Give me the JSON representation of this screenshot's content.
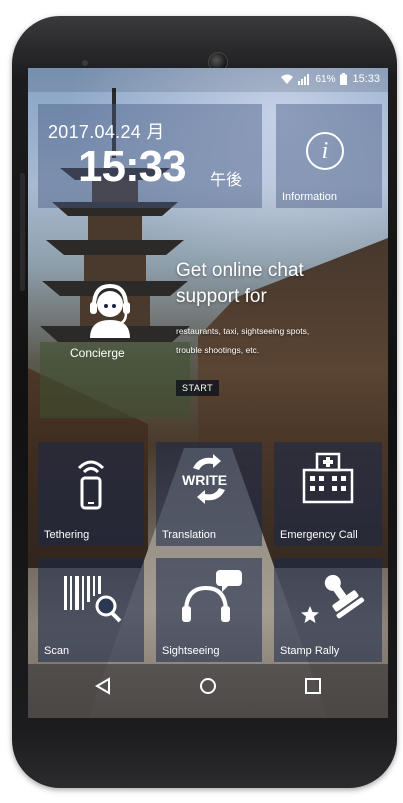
{
  "status_bar": {
    "battery_percent": "61%",
    "time": "15:33",
    "icons": [
      "wifi-icon",
      "signal-icon",
      "battery-icon"
    ]
  },
  "clock": {
    "date": "2017.04.24 月",
    "time": "15:33",
    "ampm": "午後"
  },
  "information": {
    "label": "Information",
    "icon": "info-icon"
  },
  "concierge": {
    "label": "Concierge",
    "icon": "headset-agent-icon",
    "headline_line1": "Get online chat",
    "headline_line2": "support for",
    "subtext_line1": "restaurants, taxi, sightseeing spots,",
    "subtext_line2": "trouble shootings, etc.",
    "start_label": "START"
  },
  "tiles": [
    {
      "label": "Tethering",
      "icon": "phone-wifi-icon"
    },
    {
      "label": "Translation",
      "icon": "translate-arrows-icon",
      "icon_text": "WRITE"
    },
    {
      "label": "Emergency Call",
      "icon": "hospital-icon"
    },
    {
      "label": "Scan",
      "icon": "barcode-scan-icon"
    },
    {
      "label": "Sightseeing",
      "icon": "headphones-chat-icon"
    },
    {
      "label": "Stamp Rally",
      "icon": "stamp-icon"
    }
  ],
  "nav_bar": {
    "items": [
      "back-icon",
      "home-icon",
      "recents-icon"
    ]
  },
  "colors": {
    "tile_bg": "#19284b",
    "text": "#ffffff",
    "phone_body": "#111111"
  }
}
